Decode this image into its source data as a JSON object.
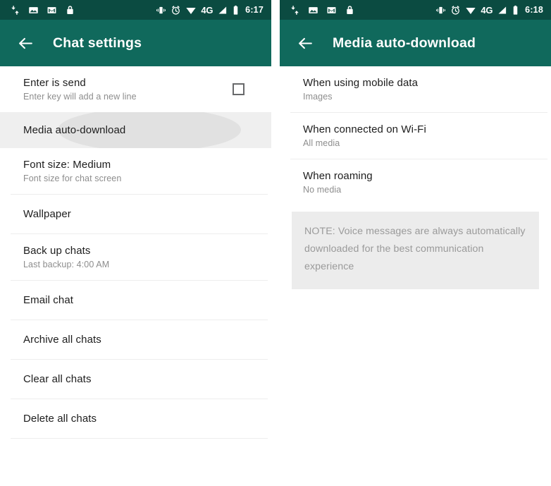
{
  "colors": {
    "statusbar_bg": "#0b4b41",
    "appbar_bg": "#10695c",
    "page_bg": "#ffffff",
    "divider": "#ededed",
    "pressed_row_bg": "#efefef",
    "ripple": "#e1e1e1",
    "note_bg": "#ececec",
    "primary_text": "#1d1d1d",
    "secondary_text": "#8d8d8d",
    "note_text": "#9a9a9a",
    "checkbox_border": "#68696b"
  },
  "screens": [
    {
      "id": "chat-settings",
      "statusbar": {
        "left_icons": [
          "sync-icon",
          "image-icon",
          "gmail-icon",
          "lock-icon"
        ],
        "right_icons": [
          "vibrate-icon",
          "alarm-icon",
          "wifi-icon",
          "signal-icon",
          "battery-icon"
        ],
        "network_label": "4G",
        "time": "6:17"
      },
      "appbar": {
        "back_icon": "back-arrow-icon",
        "title": "Chat settings"
      },
      "items": [
        {
          "title": "Enter is send",
          "subtitle": "Enter key will add a new line",
          "control": "checkbox",
          "checked": false,
          "divider_after": false,
          "state": "normal"
        },
        {
          "title": "Media auto-download",
          "subtitle": "",
          "control": "none",
          "divider_after": false,
          "state": "pressed"
        },
        {
          "title": "Font size: Medium",
          "subtitle": "Font size for chat screen",
          "control": "none",
          "divider_after": true,
          "state": "normal"
        },
        {
          "title": "Wallpaper",
          "subtitle": "",
          "control": "none",
          "divider_after": true,
          "state": "normal"
        },
        {
          "title": "Back up chats",
          "subtitle": "Last backup: 4:00 AM",
          "control": "none",
          "divider_after": true,
          "state": "normal"
        },
        {
          "title": "Email chat",
          "subtitle": "",
          "control": "none",
          "divider_after": true,
          "state": "normal"
        },
        {
          "title": "Archive all chats",
          "subtitle": "",
          "control": "none",
          "divider_after": true,
          "state": "normal"
        },
        {
          "title": "Clear all chats",
          "subtitle": "",
          "control": "none",
          "divider_after": true,
          "state": "normal"
        },
        {
          "title": "Delete all chats",
          "subtitle": "",
          "control": "none",
          "divider_after": true,
          "state": "normal"
        }
      ],
      "note": null
    },
    {
      "id": "media-auto-download",
      "statusbar": {
        "left_icons": [
          "sync-icon",
          "image-icon",
          "gmail-icon",
          "lock-icon"
        ],
        "right_icons": [
          "vibrate-icon",
          "alarm-icon",
          "wifi-icon",
          "signal-icon",
          "battery-icon"
        ],
        "network_label": "4G",
        "time": "6:18"
      },
      "appbar": {
        "back_icon": "back-arrow-icon",
        "title": "Media auto-download"
      },
      "items": [
        {
          "title": "When using mobile data",
          "subtitle": "Images",
          "control": "none",
          "divider_after": true,
          "state": "normal"
        },
        {
          "title": "When connected on Wi-Fi",
          "subtitle": "All media",
          "control": "none",
          "divider_after": true,
          "state": "normal"
        },
        {
          "title": "When roaming",
          "subtitle": "No media",
          "control": "none",
          "divider_after": false,
          "state": "normal"
        }
      ],
      "note": "NOTE: Voice messages are always automatically downloaded for the best communication experience"
    }
  ]
}
